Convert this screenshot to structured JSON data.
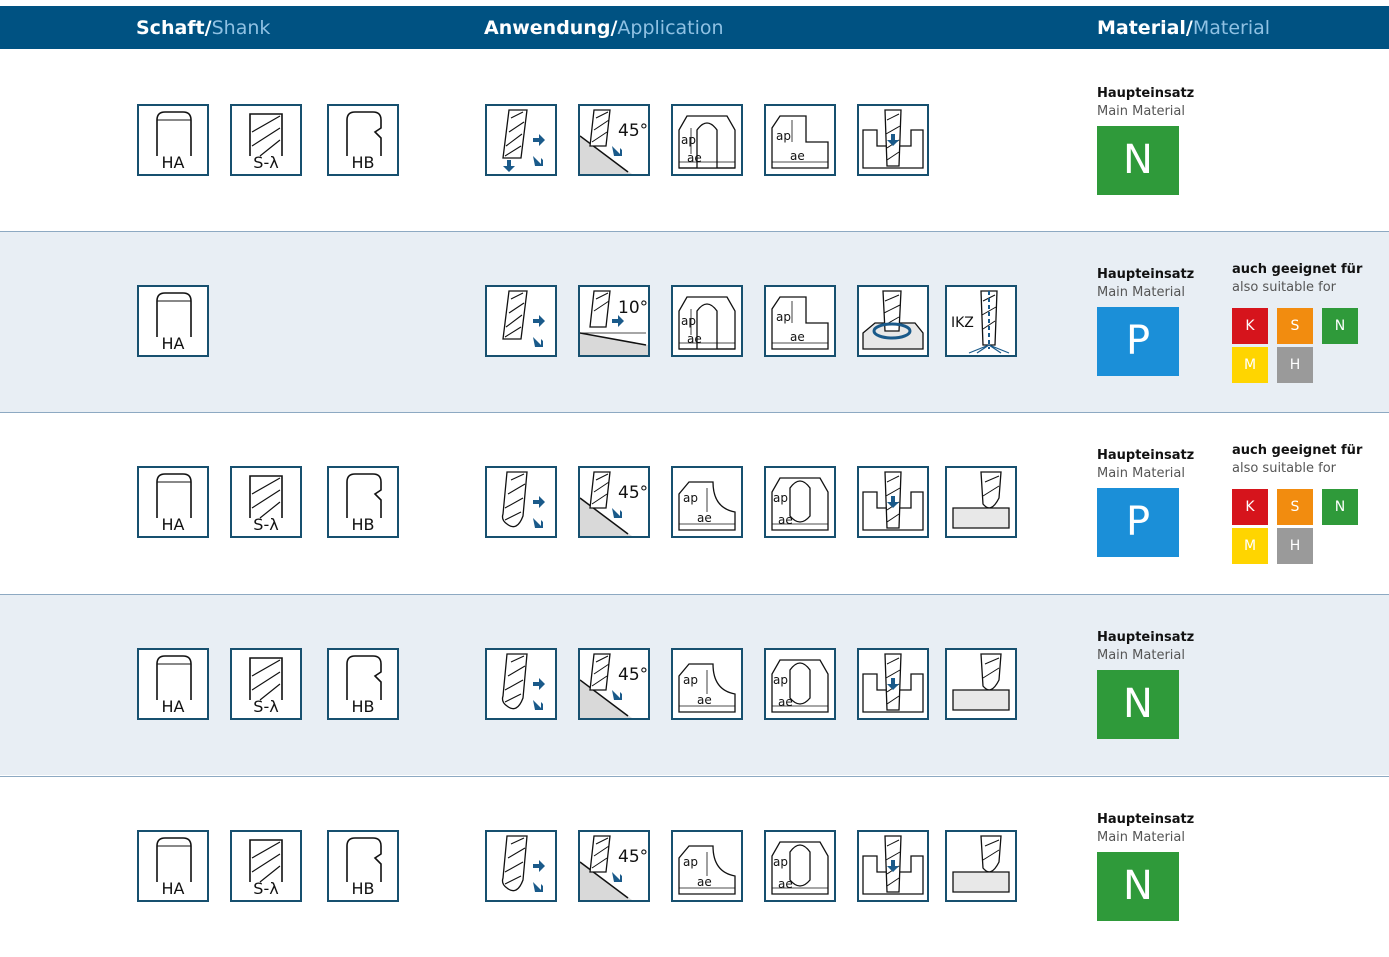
{
  "header": {
    "schaft": "Schaft/",
    "shank": "Shank",
    "anwendung": "Anwendung/",
    "application": "Application",
    "material_de": "Material/",
    "material_en": "Material"
  },
  "shank_labels": {
    "ha": "HA",
    "sl": "S-λ",
    "hb": "HB"
  },
  "materials": {
    "main_de": "Haupteinsatz",
    "main_en": "Main Material",
    "also_de": "auch geeignet für",
    "also_en": "also suitable for"
  },
  "icon_text": {
    "angle45": "45°",
    "angle10": "10°",
    "ap": "ap",
    "ae": "ae",
    "ikz": "IKZ"
  },
  "rows": [
    {
      "main": "N",
      "also": []
    },
    {
      "main": "P",
      "also": [
        "K",
        "S",
        "N",
        "M",
        "H"
      ]
    },
    {
      "main": "P",
      "also": [
        "K",
        "S",
        "N",
        "M",
        "H"
      ]
    },
    {
      "main": "N",
      "also": []
    },
    {
      "main": "N",
      "also": []
    }
  ],
  "colors": {
    "header": "#005282",
    "icon_border": "#17506f",
    "arrow": "#1a5a8a",
    "N": "#2f9a3a",
    "P": "#1b8fd8",
    "K": "#d6141c",
    "S": "#f28c0f",
    "M": "#ffd500",
    "H": "#9a9a9a"
  }
}
